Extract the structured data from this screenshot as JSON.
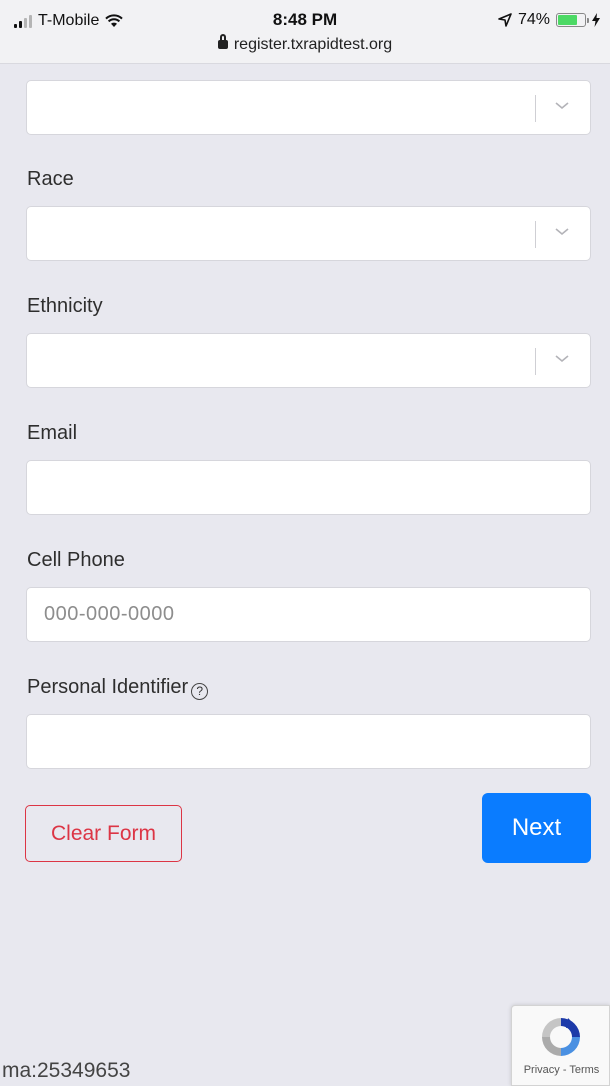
{
  "status_bar": {
    "carrier": "T-Mobile",
    "time": "8:48 PM",
    "url": "register.txrapidtest.org",
    "battery": "74%",
    "battery_level": 0.74
  },
  "form": {
    "top_select_value": "",
    "race": {
      "label": "Race",
      "value": ""
    },
    "ethnicity": {
      "label": "Ethnicity",
      "value": ""
    },
    "email": {
      "label": "Email",
      "value": ""
    },
    "cell_phone": {
      "label": "Cell Phone",
      "placeholder": "000-000-0000"
    },
    "personal_identifier": {
      "label": "Personal Identifier",
      "help": "?",
      "value": ""
    },
    "clear_label": "Clear Form",
    "next_label": "Next"
  },
  "recaptcha": {
    "links": "Privacy - Terms"
  },
  "footer_id": "ma:25349653",
  "colors": {
    "primary": "#0a7cff",
    "danger": "#dc3545",
    "background": "#e8e8ef"
  }
}
